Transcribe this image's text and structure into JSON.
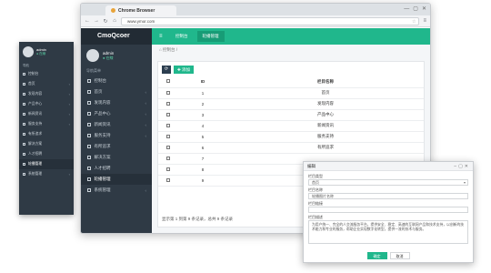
{
  "colors": {
    "accent": "#20b78c",
    "sidebar": "#2f3a45",
    "logo_bg": "#222b34"
  },
  "mini_sidebar": {
    "user": {
      "name": "admin",
      "status": "● 在線"
    },
    "sub": "导航",
    "items": [
      {
        "label": "控制台",
        "icon": "dashboard-icon"
      },
      {
        "label": "首页",
        "icon": "home-icon"
      },
      {
        "label": "发现内容",
        "icon": "compass-icon"
      },
      {
        "label": "产品中心",
        "icon": "box-icon"
      },
      {
        "label": "新闻资讯",
        "icon": "news-icon"
      },
      {
        "label": "服务支持",
        "icon": "support-icon"
      },
      {
        "label": "有所追求",
        "icon": "target-icon"
      },
      {
        "label": "解决方案",
        "icon": "solution-icon"
      },
      {
        "label": "人才招聘",
        "icon": "users-icon"
      },
      {
        "label": "轮播管理",
        "icon": "images-icon"
      },
      {
        "label": "系统管理",
        "icon": "gear-icon"
      }
    ]
  },
  "browser": {
    "tab_title": "Chrome Browser",
    "url": "www.ymor.com",
    "window_buttons": [
      "—",
      "▢",
      "✕"
    ]
  },
  "app": {
    "logo": "CmoQcoer",
    "user": {
      "name": "admin",
      "status": "● 在線"
    },
    "sub": "导航菜单",
    "menu": [
      {
        "label": "控制台",
        "icon": "dashboard-icon",
        "chev": ""
      },
      {
        "label": "首页",
        "icon": "home-icon",
        "chev": "‹"
      },
      {
        "label": "发现内容",
        "icon": "compass-icon",
        "chev": "‹"
      },
      {
        "label": "产品中心",
        "icon": "box-icon",
        "chev": "‹"
      },
      {
        "label": "新闻资讯",
        "icon": "news-icon",
        "chev": "‹"
      },
      {
        "label": "服务支持",
        "icon": "support-icon",
        "chev": "‹"
      },
      {
        "label": "有所追求",
        "icon": "target-icon",
        "chev": ""
      },
      {
        "label": "解决方案",
        "icon": "solution-icon",
        "chev": ""
      },
      {
        "label": "人才招聘",
        "icon": "users-icon",
        "chev": ""
      },
      {
        "label": "轮播管理",
        "icon": "images-icon",
        "chev": ""
      },
      {
        "label": "系统管理",
        "icon": "gear-icon",
        "chev": "‹"
      }
    ],
    "top_tabs": [
      "控制台",
      "轮播管理"
    ],
    "breadcrumb": "⌂ 控制台 /",
    "add_button": "✚ 添加",
    "table": {
      "headers": [
        "",
        "ID",
        "栏目名称"
      ],
      "rows": [
        [
          "1",
          "首页"
        ],
        [
          "2",
          "发现内容"
        ],
        [
          "3",
          "产品中心"
        ],
        [
          "4",
          "新闻资讯"
        ],
        [
          "5",
          "服务支持"
        ],
        [
          "6",
          "有所追求"
        ],
        [
          "7",
          ""
        ],
        [
          "8",
          ""
        ],
        [
          "9",
          ""
        ]
      ]
    },
    "pagination": "显示第 1 到第 9 条记录，总共 9 条记录"
  },
  "dialog": {
    "title": "编辑",
    "fields": [
      {
        "label": "栏目类型",
        "value": "首页",
        "dropdown": true
      },
      {
        "label": "栏目名称",
        "value": "轮播图片名称",
        "dropdown": false
      },
      {
        "label": "栏目链接",
        "value": "",
        "dropdown": false
      }
    ],
    "textarea_label": "栏目描述",
    "textarea_value": "为用户统一、完全的人交流服务平台，提供安全、稳定、高速的互联网产品和技术支持，以创新的技术能力和专业的服务，帮助企业实现数字化转型，提供一流的技术与服务。",
    "buttons": {
      "confirm": "确定",
      "cancel": "取消"
    }
  }
}
